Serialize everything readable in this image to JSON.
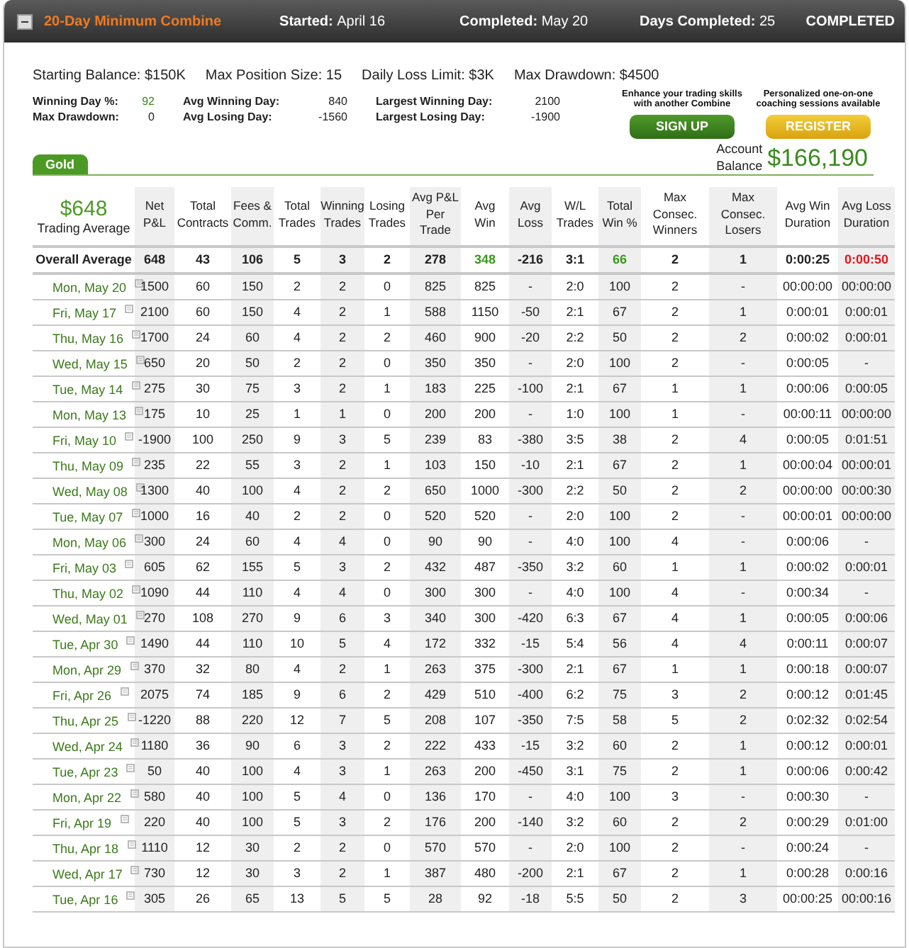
{
  "header": {
    "title": "20-Day Minimum Combine",
    "started": {
      "label": "Started:",
      "value": "April 16"
    },
    "completed": {
      "label": "Completed:",
      "value": "May 20"
    },
    "days_completed": {
      "label": "Days Completed:",
      "value": "25"
    },
    "status": "COMPLETED"
  },
  "summary": [
    {
      "label": "Starting Balance:",
      "value": "$150K"
    },
    {
      "label": "Max Position Size:",
      "value": "15"
    },
    {
      "label": "Daily Loss Limit:",
      "value": "$3K"
    },
    {
      "label": "Max Drawdown:",
      "value": "$4500"
    }
  ],
  "stats": [
    [
      {
        "label": "Winning Day %:",
        "value": "92",
        "positive": true
      },
      {
        "label": "Max Drawdown:",
        "value": "0",
        "positive": false
      }
    ],
    [
      {
        "label": "Avg Winning Day:",
        "value": "840",
        "positive": false
      },
      {
        "label": "Avg Losing Day:",
        "value": "-1560",
        "positive": false
      }
    ],
    [
      {
        "label": "Largest Winning Day:",
        "value": "2100",
        "positive": false
      },
      {
        "label": "Largest Losing Day:",
        "value": "-1900",
        "positive": false
      }
    ]
  ],
  "promos": [
    {
      "kind": "signup",
      "text": "Enhance your trading skills with another Combine",
      "button": "SIGN UP"
    },
    {
      "kind": "register",
      "text": "Personalized one-on-one coaching sessions available",
      "button": "REGISTER"
    }
  ],
  "tab": {
    "label": "Gold",
    "selected": true
  },
  "account": {
    "label": "Account Balance",
    "value": "$166,190"
  },
  "average": {
    "value": "$648",
    "label": "Trading Average"
  },
  "columns": [
    "Net\nP&L",
    "Total\nContracts",
    "Fees &\nComm.",
    "Total\nTrades",
    "Winning\nTrades",
    "Losing\nTrades",
    "Avg P&L\nPer Trade",
    "Avg\nWin",
    "Avg\nLoss",
    "W/L\nTrades",
    "Total\nWin %",
    "Max Consec.\nWinners",
    "Max Consec.\nLosers",
    "Avg Win\nDuration",
    "Avg Loss\nDuration"
  ],
  "overall": {
    "label": "Overall Average",
    "cells": [
      {
        "text": "648"
      },
      {
        "text": "43"
      },
      {
        "text": "106"
      },
      {
        "text": "5"
      },
      {
        "text": "3"
      },
      {
        "text": "2"
      },
      {
        "text": "278"
      },
      {
        "text": "348",
        "color": "#3a9a1e"
      },
      {
        "text": "-216"
      },
      {
        "text": "3:1"
      },
      {
        "text": "66",
        "color": "#3a9a1e"
      },
      {
        "text": "2"
      },
      {
        "text": "1"
      },
      {
        "text": "0:00:25"
      },
      {
        "text": "0:00:50",
        "color": "#e8141a"
      }
    ]
  },
  "rows": [
    {
      "date": "Mon, May 20",
      "cells": [
        "1500",
        "60",
        "150",
        "2",
        "2",
        "0",
        "825",
        "825",
        "-",
        "2:0",
        "100",
        "2",
        "-",
        "00:00:00",
        "00:00:00"
      ]
    },
    {
      "date": "Fri, May 17",
      "cells": [
        "2100",
        "60",
        "150",
        "4",
        "2",
        "1",
        "588",
        "1150",
        "-50",
        "2:1",
        "67",
        "2",
        "1",
        "0:00:01",
        "0:00:01"
      ]
    },
    {
      "date": "Thu, May 16",
      "cells": [
        "1700",
        "24",
        "60",
        "4",
        "2",
        "2",
        "460",
        "900",
        "-20",
        "2:2",
        "50",
        "2",
        "2",
        "0:00:02",
        "0:00:01"
      ]
    },
    {
      "date": "Wed, May 15",
      "cells": [
        "650",
        "20",
        "50",
        "2",
        "2",
        "0",
        "350",
        "350",
        "-",
        "2:0",
        "100",
        "2",
        "-",
        "0:00:05",
        "-"
      ]
    },
    {
      "date": "Tue, May 14",
      "cells": [
        "275",
        "30",
        "75",
        "3",
        "2",
        "1",
        "183",
        "225",
        "-100",
        "2:1",
        "67",
        "1",
        "1",
        "0:00:06",
        "0:00:05"
      ]
    },
    {
      "date": "Mon, May 13",
      "cells": [
        "175",
        "10",
        "25",
        "1",
        "1",
        "0",
        "200",
        "200",
        "-",
        "1:0",
        "100",
        "1",
        "-",
        "00:00:11",
        "00:00:00"
      ]
    },
    {
      "date": "Fri, May 10",
      "cells": [
        "-1900",
        "100",
        "250",
        "9",
        "3",
        "5",
        "239",
        "83",
        "-380",
        "3:5",
        "38",
        "2",
        "4",
        "0:00:05",
        "0:01:51"
      ]
    },
    {
      "date": "Thu, May 09",
      "cells": [
        "235",
        "22",
        "55",
        "3",
        "2",
        "1",
        "103",
        "150",
        "-10",
        "2:1",
        "67",
        "2",
        "1",
        "00:00:04",
        "00:00:01"
      ]
    },
    {
      "date": "Wed, May 08",
      "cells": [
        "1300",
        "40",
        "100",
        "4",
        "2",
        "2",
        "650",
        "1000",
        "-300",
        "2:2",
        "50",
        "2",
        "2",
        "00:00:00",
        "00:00:30"
      ]
    },
    {
      "date": "Tue, May 07",
      "cells": [
        "1000",
        "16",
        "40",
        "2",
        "2",
        "0",
        "520",
        "520",
        "-",
        "2:0",
        "100",
        "2",
        "-",
        "00:00:01",
        "00:00:00"
      ]
    },
    {
      "date": "Mon, May 06",
      "cells": [
        "300",
        "24",
        "60",
        "4",
        "4",
        "0",
        "90",
        "90",
        "-",
        "4:0",
        "100",
        "4",
        "-",
        "0:00:06",
        "-"
      ]
    },
    {
      "date": "Fri, May 03",
      "cells": [
        "605",
        "62",
        "155",
        "5",
        "3",
        "2",
        "432",
        "487",
        "-350",
        "3:2",
        "60",
        "1",
        "1",
        "0:00:02",
        "0:00:01"
      ]
    },
    {
      "date": "Thu, May 02",
      "cells": [
        "1090",
        "44",
        "110",
        "4",
        "4",
        "0",
        "300",
        "300",
        "-",
        "4:0",
        "100",
        "4",
        "-",
        "0:00:34",
        "-"
      ]
    },
    {
      "date": "Wed, May 01",
      "cells": [
        "270",
        "108",
        "270",
        "9",
        "6",
        "3",
        "340",
        "300",
        "-420",
        "6:3",
        "67",
        "4",
        "1",
        "0:00:05",
        "0:00:06"
      ]
    },
    {
      "date": "Tue, Apr 30",
      "cells": [
        "1490",
        "44",
        "110",
        "10",
        "5",
        "4",
        "172",
        "332",
        "-15",
        "5:4",
        "56",
        "4",
        "4",
        "0:00:11",
        "0:00:07"
      ]
    },
    {
      "date": "Mon, Apr 29",
      "cells": [
        "370",
        "32",
        "80",
        "4",
        "2",
        "1",
        "263",
        "375",
        "-300",
        "2:1",
        "67",
        "1",
        "1",
        "0:00:18",
        "0:00:07"
      ]
    },
    {
      "date": "Fri, Apr 26",
      "cells": [
        "2075",
        "74",
        "185",
        "9",
        "6",
        "2",
        "429",
        "510",
        "-400",
        "6:2",
        "75",
        "3",
        "2",
        "0:00:12",
        "0:01:45"
      ]
    },
    {
      "date": "Thu, Apr 25",
      "cells": [
        "-1220",
        "88",
        "220",
        "12",
        "7",
        "5",
        "208",
        "107",
        "-350",
        "7:5",
        "58",
        "5",
        "2",
        "0:02:32",
        "0:02:54"
      ]
    },
    {
      "date": "Wed, Apr 24",
      "cells": [
        "1180",
        "36",
        "90",
        "6",
        "3",
        "2",
        "222",
        "433",
        "-15",
        "3:2",
        "60",
        "2",
        "1",
        "0:00:12",
        "0:00:01"
      ]
    },
    {
      "date": "Tue, Apr 23",
      "cells": [
        "50",
        "40",
        "100",
        "4",
        "3",
        "1",
        "263",
        "200",
        "-450",
        "3:1",
        "75",
        "2",
        "1",
        "0:00:06",
        "0:00:42"
      ]
    },
    {
      "date": "Mon, Apr 22",
      "cells": [
        "580",
        "40",
        "100",
        "5",
        "4",
        "0",
        "136",
        "170",
        "-",
        "4:0",
        "100",
        "3",
        "-",
        "0:00:30",
        "-"
      ]
    },
    {
      "date": "Fri, Apr 19",
      "cells": [
        "220",
        "40",
        "100",
        "5",
        "3",
        "2",
        "176",
        "200",
        "-140",
        "3:2",
        "60",
        "2",
        "2",
        "0:00:29",
        "0:01:00"
      ]
    },
    {
      "date": "Thu, Apr 18",
      "cells": [
        "1110",
        "12",
        "30",
        "2",
        "2",
        "0",
        "570",
        "570",
        "-",
        "2:0",
        "100",
        "2",
        "-",
        "0:00:24",
        "-"
      ]
    },
    {
      "date": "Wed, Apr 17",
      "cells": [
        "730",
        "12",
        "30",
        "3",
        "2",
        "1",
        "387",
        "480",
        "-200",
        "2:1",
        "67",
        "2",
        "1",
        "0:00:28",
        "0:00:16"
      ]
    },
    {
      "date": "Tue, Apr 16",
      "cells": [
        "305",
        "26",
        "65",
        "13",
        "5",
        "5",
        "28",
        "92",
        "-18",
        "5:5",
        "50",
        "2",
        "3",
        "00:00:25",
        "00:00:16"
      ]
    }
  ]
}
